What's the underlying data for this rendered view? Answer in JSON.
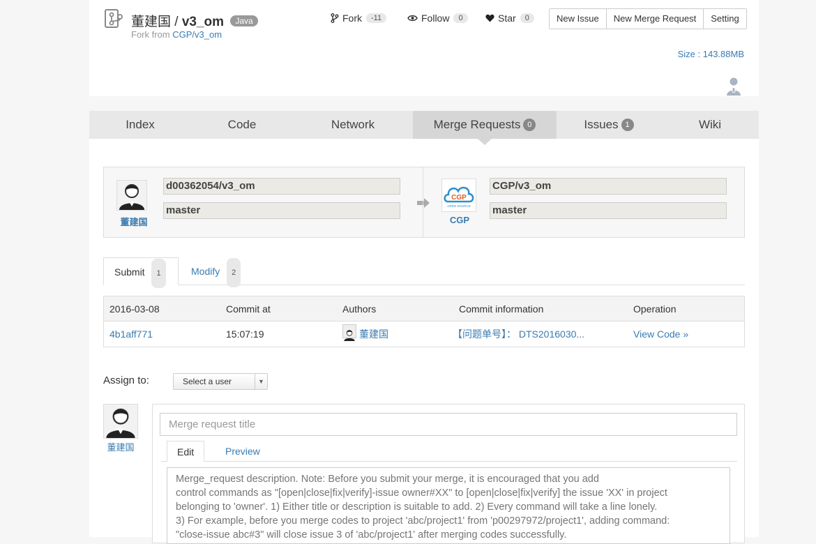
{
  "header": {
    "owner": "董建国",
    "separator": "/",
    "repo": "v3_om",
    "language": "Java",
    "fork_from_label": "Fork from",
    "fork_from_link": "CGP/v3_om",
    "stats": {
      "fork_label": "Fork",
      "fork_count": "-11",
      "follow_label": "Follow",
      "follow_count": "0",
      "star_label": "Star",
      "star_count": "0"
    },
    "buttons": {
      "new_issue": "New Issue",
      "new_merge_request": "New Merge Request",
      "setting": "Setting"
    },
    "size": "Size : 143.88MB"
  },
  "nav": {
    "tabs": [
      {
        "label": "Index"
      },
      {
        "label": "Code"
      },
      {
        "label": "Network"
      },
      {
        "label": "Merge Requests",
        "badge": "0"
      },
      {
        "label": "Issues",
        "badge": "1"
      },
      {
        "label": "Wiki"
      }
    ]
  },
  "merge": {
    "source": {
      "user": "董建国",
      "project": "d00362054/v3_om",
      "branch": "master"
    },
    "target": {
      "user": "CGP",
      "logo_text": "CGP",
      "logo_subtext": "OPEN SOURCE",
      "project": "CGP/v3_om",
      "branch": "master"
    }
  },
  "commit_tabs": [
    {
      "label": "Submit",
      "count": "1"
    },
    {
      "label": "Modify",
      "count": "2"
    }
  ],
  "commit_table": {
    "headers": [
      "2016-03-08",
      "Commit at",
      "Authors",
      "Commit information",
      "Operation"
    ],
    "rows": [
      {
        "id": "4b1aff771",
        "time": "15:07:19",
        "author": "董建国",
        "info": "【问题单号】： DTS2016030...",
        "operation": "View Code »"
      }
    ]
  },
  "assign": {
    "label": "Assign to:",
    "select_value": "Select a user"
  },
  "form": {
    "user": "董建国",
    "title_placeholder": "Merge request title",
    "tabs": [
      "Edit",
      "Preview"
    ],
    "description_placeholder": "Merge_request description. Note: Before you submit your merge, it is encouraged that you add\ncontrol commands as \"[open|close|fix|verify]-issue owner#XX\" to [open|close|fix|verify] the issue 'XX' in project\nbelonging to 'owner'. 1) Either title or description is suitable to add. 2) Every command will take a line lonely.\n3) For example, before you merge codes to project 'abc/project1' from 'p00297972/project1', adding command:\n\"close-issue abc#3\" will close issue 3 of 'abc/project1' after merging codes successfully."
  },
  "colors": {
    "link": "#3a7bb0",
    "nav_bg": "#e8e8e8",
    "nav_active": "#d6d6d6",
    "badge": "#888888"
  }
}
